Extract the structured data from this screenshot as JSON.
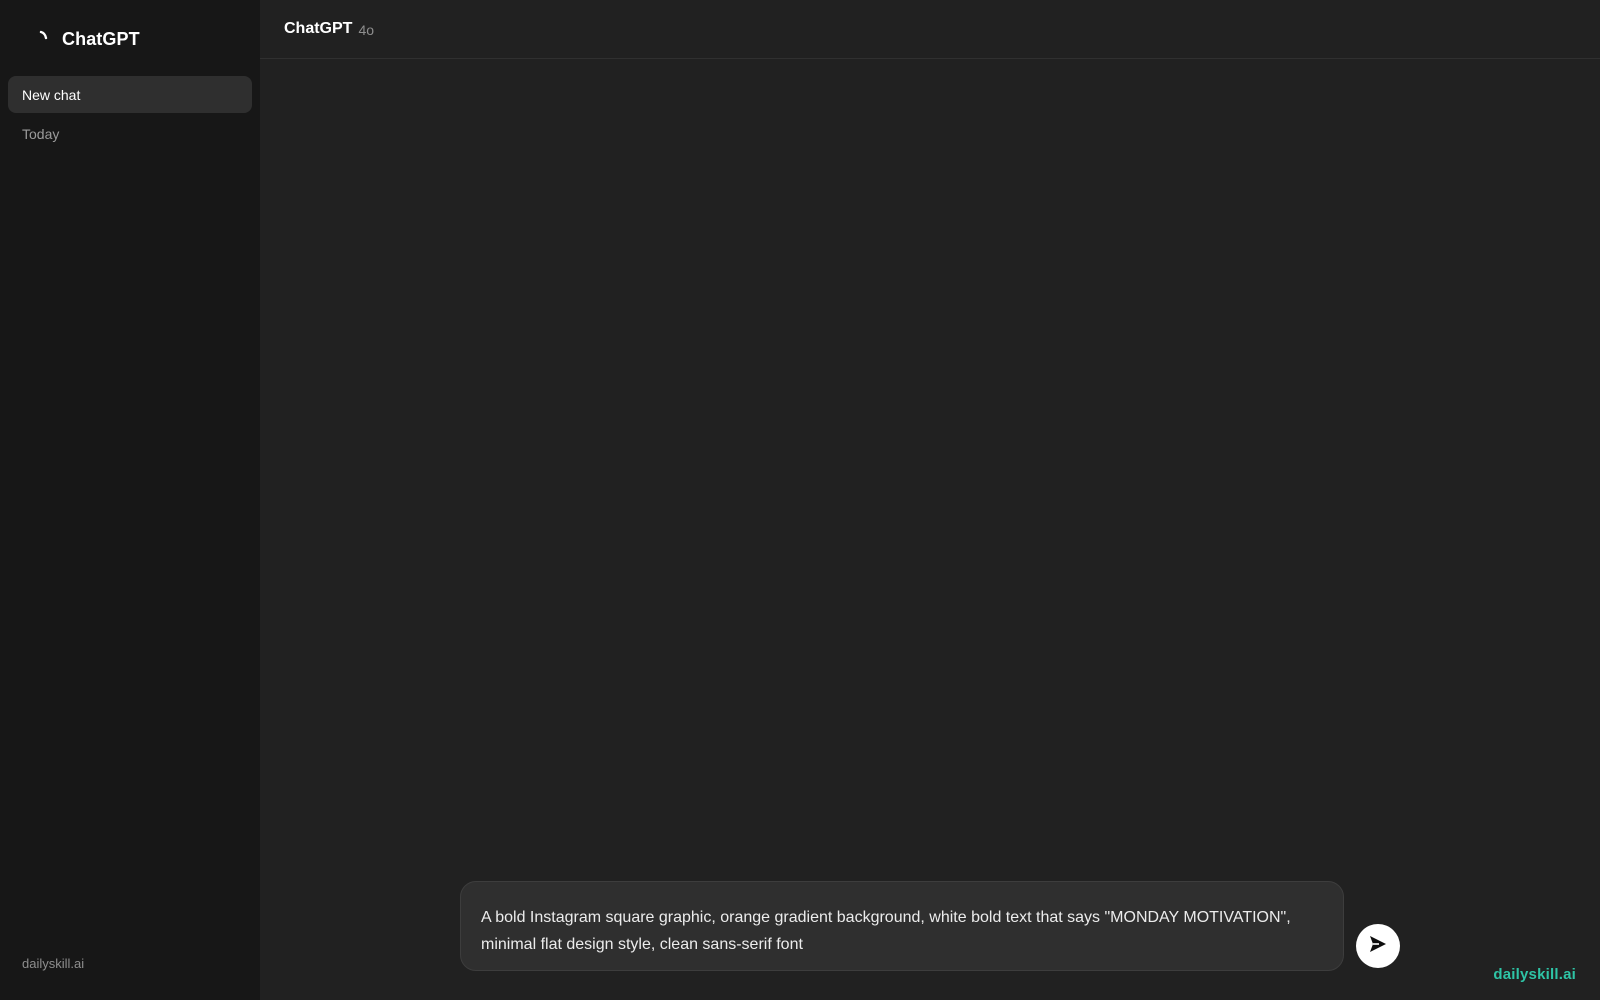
{
  "sidebar": {
    "brand_name": "ChatGPT",
    "brand_icon": "chatgpt-logo-icon",
    "new_chat_label": "New chat",
    "section_today": "Today",
    "footer_text": "dailyskill.ai"
  },
  "header": {
    "model_name": "ChatGPT",
    "model_version": "4o"
  },
  "composer": {
    "value": "A bold Instagram square graphic, orange gradient background, white bold text that says \"MONDAY MOTIVATION\", minimal flat design style, clean sans-serif font",
    "send_icon": "send-arrow-icon"
  },
  "watermark": {
    "text": "dailyskill.ai"
  },
  "colors": {
    "sidebar_bg": "#171717",
    "main_bg": "#212121",
    "composer_bg": "#2f2f2f",
    "watermark": "#2ec4a6",
    "send_button_bg": "#ffffff"
  }
}
